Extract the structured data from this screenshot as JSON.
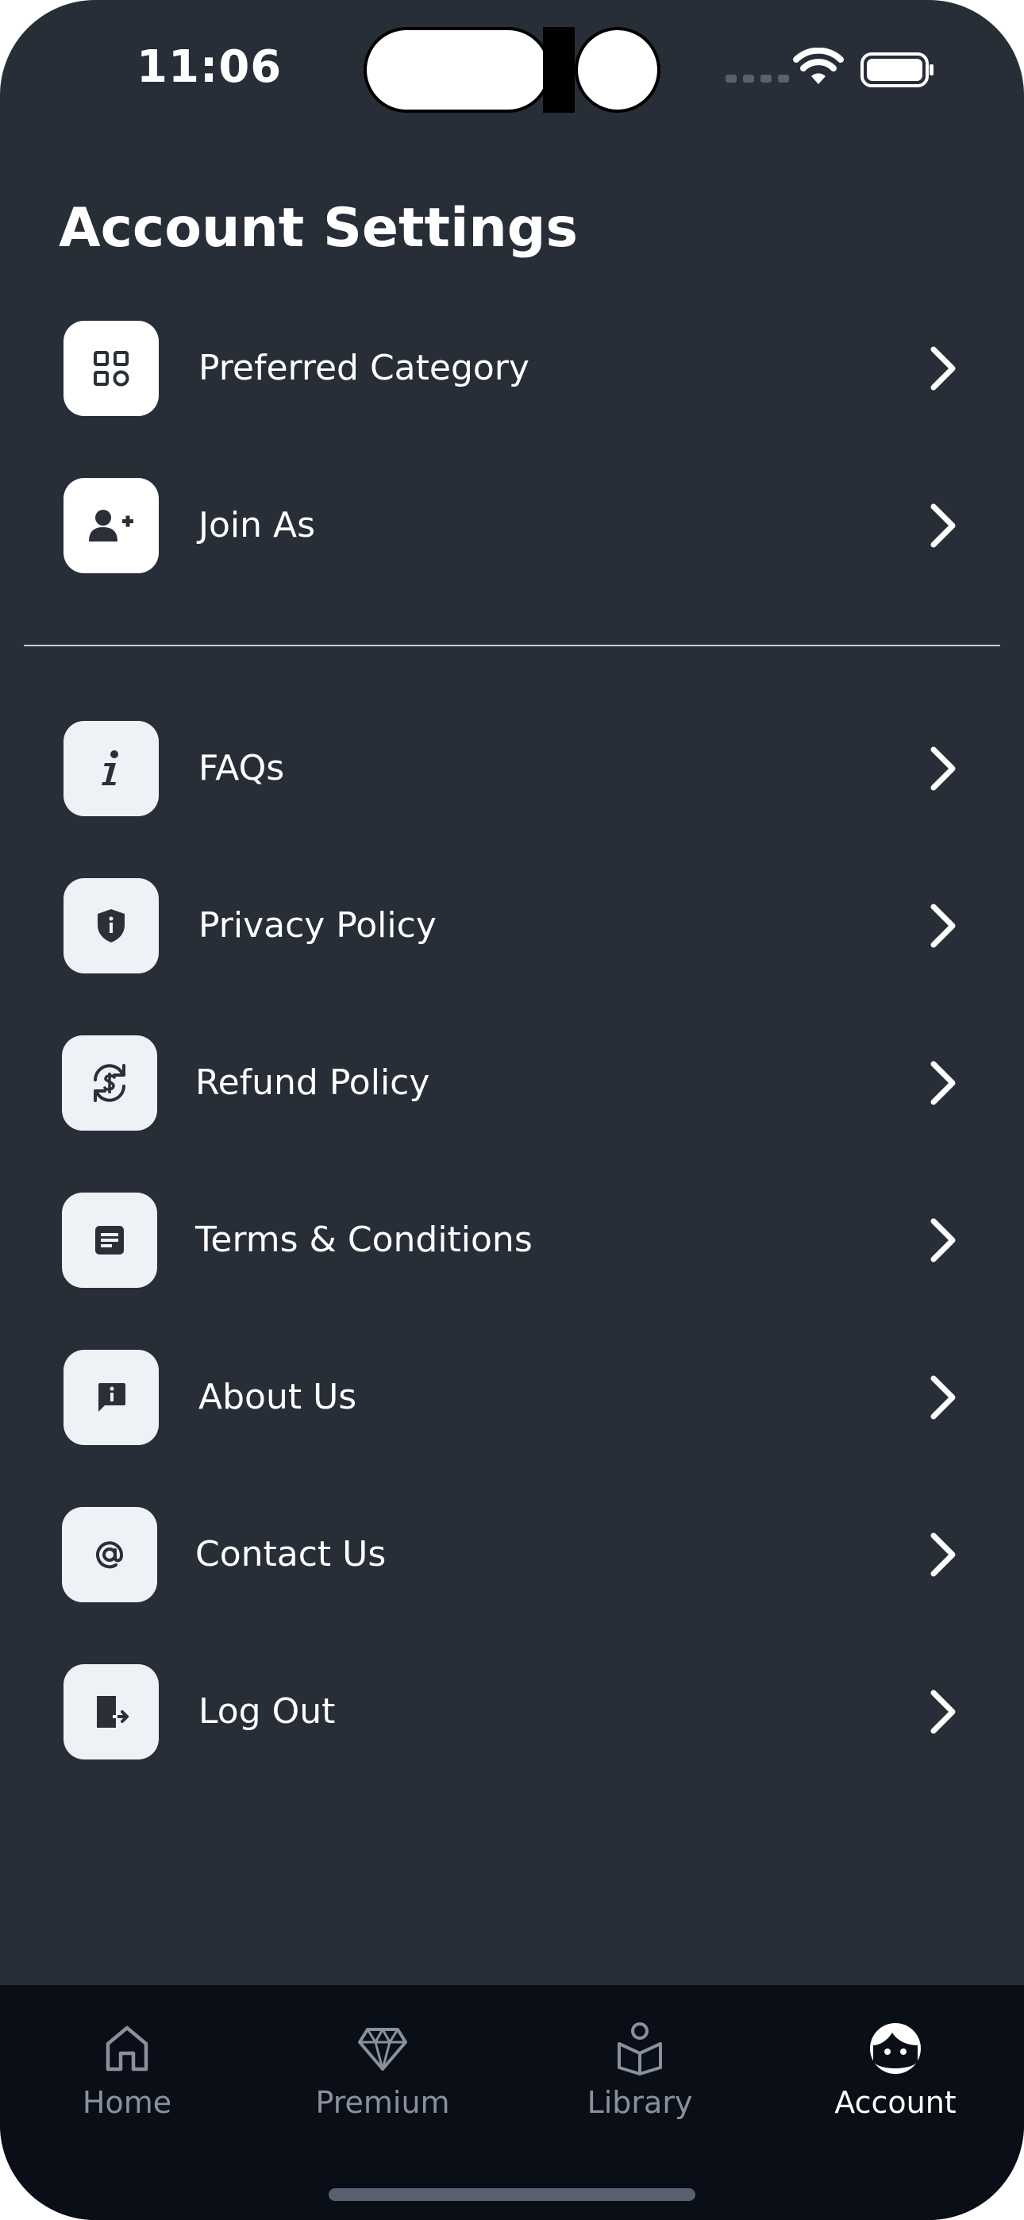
{
  "status_bar": {
    "time": "11:06"
  },
  "header": {
    "title": "Account Settings"
  },
  "settings": {
    "items": [
      {
        "label": "Preferred Category",
        "icon": "grid-icon"
      },
      {
        "label": "Join As",
        "icon": "user-add-icon"
      }
    ]
  },
  "info": {
    "items": [
      {
        "label": "FAQs",
        "icon": "info-icon"
      },
      {
        "label": "Privacy Policy",
        "icon": "shield-icon"
      },
      {
        "label": "Refund Policy",
        "icon": "refund-icon"
      },
      {
        "label": "Terms & Conditions",
        "icon": "document-icon"
      },
      {
        "label": "About Us",
        "icon": "message-info-icon"
      },
      {
        "label": "Contact Us",
        "icon": "at-icon"
      },
      {
        "label": "Log Out",
        "icon": "logout-icon"
      }
    ]
  },
  "tabs": [
    {
      "label": "Home",
      "icon": "home-icon",
      "active": false
    },
    {
      "label": "Premium",
      "icon": "diamond-icon",
      "active": false
    },
    {
      "label": "Library",
      "icon": "library-icon",
      "active": false
    },
    {
      "label": "Account",
      "icon": "face-icon",
      "active": true
    }
  ],
  "colors": {
    "background": "#282e38",
    "tabbar": "#0a0e17",
    "icon_tile": "#ffffff",
    "text": "#ffffff",
    "inactive_tab": "#8a909c"
  }
}
